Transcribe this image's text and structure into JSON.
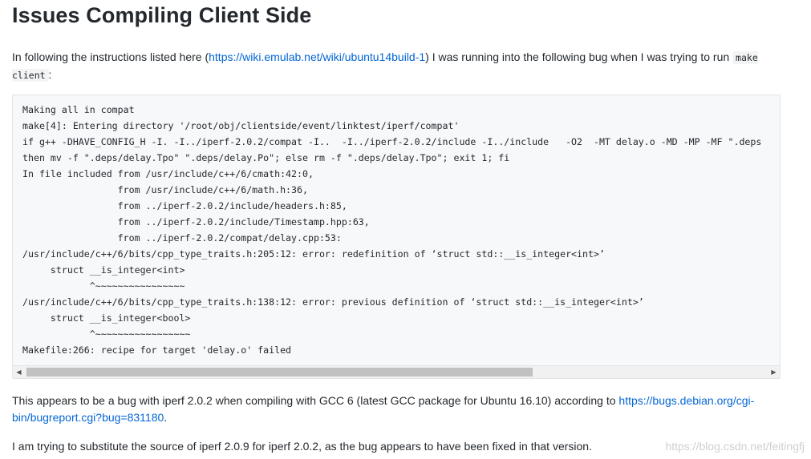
{
  "title": "Issues Compiling Client Side",
  "intro": {
    "text_before": "In following the instructions listed here (",
    "link_text": "https://wiki.emulab.net/wiki/ubuntu14build-1",
    "text_after": ") I was running into the following bug when I was trying to run ",
    "code": "make client",
    "end": ":"
  },
  "code_lines": [
    "Making all in compat",
    "make[4]: Entering directory '/root/obj/clientside/event/linktest/iperf/compat'",
    "if g++ -DHAVE_CONFIG_H -I. -I../iperf-2.0.2/compat -I..  -I../iperf-2.0.2/include -I../include   -O2  -MT delay.o -MD -MP -MF \".deps",
    "then mv -f \".deps/delay.Tpo\" \".deps/delay.Po\"; else rm -f \".deps/delay.Tpo\"; exit 1; fi",
    "In file included from /usr/include/c++/6/cmath:42:0,",
    "                 from /usr/include/c++/6/math.h:36,",
    "                 from ../iperf-2.0.2/include/headers.h:85,",
    "                 from ../iperf-2.0.2/include/Timestamp.hpp:63,",
    "                 from ../iperf-2.0.2/compat/delay.cpp:53:",
    "/usr/include/c++/6/bits/cpp_type_traits.h:205:12: error: redefinition of ‘struct std::__is_integer<int>’",
    "     struct __is_integer<int>",
    "            ^~~~~~~~~~~~~~~~~",
    "/usr/include/c++/6/bits/cpp_type_traits.h:138:12: error: previous definition of ‘struct std::__is_integer<int>’",
    "     struct __is_integer<bool>",
    "            ^~~~~~~~~~~~~~~~~~",
    "Makefile:266: recipe for target 'delay.o' failed"
  ],
  "bug_para": {
    "text": "This appears to be a bug with iperf 2.0.2 when compiling with GCC 6 (latest GCC package for Ubuntu 16.10) according to ",
    "link_text": "https://bugs.debian.org/cgi-bin/bugreport.cgi?bug=831180",
    "end": "."
  },
  "substitute_para": "I am trying to substitute the source of iperf 2.0.9 for iperf 2.0.2, as the bug appears to have been fixed in that version.",
  "watermark": "https://blog.csdn.net/feitingfj",
  "scrollbar": {
    "left_arrow": "◀",
    "right_arrow": "▶"
  },
  "colors": {
    "link": "#0366d6",
    "code_bg": "#f6f8fa",
    "text": "#24292e"
  }
}
